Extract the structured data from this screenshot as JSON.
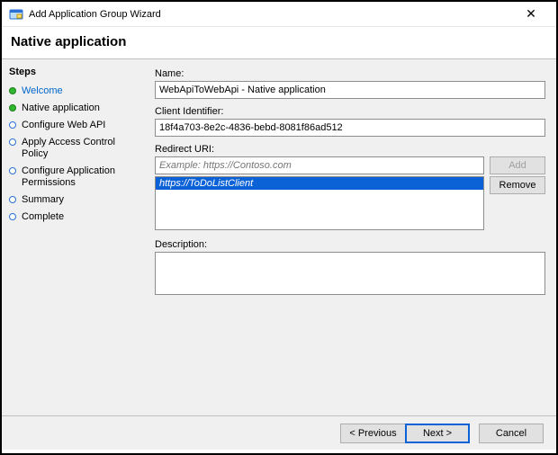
{
  "window": {
    "title": "Add Application Group Wizard",
    "close_symbol": "✕"
  },
  "header": {
    "page_title": "Native application"
  },
  "sidebar": {
    "steps_label": "Steps",
    "items": [
      {
        "label": "Welcome",
        "status": "done",
        "link": true
      },
      {
        "label": "Native application",
        "status": "done",
        "link": false
      },
      {
        "label": "Configure Web API",
        "status": "pending",
        "link": false
      },
      {
        "label": "Apply Access Control Policy",
        "status": "pending",
        "link": false
      },
      {
        "label": "Configure Application Permissions",
        "status": "pending",
        "link": false
      },
      {
        "label": "Summary",
        "status": "pending",
        "link": false
      },
      {
        "label": "Complete",
        "status": "pending",
        "link": false
      }
    ]
  },
  "form": {
    "name_label": "Name:",
    "name_value": "WebApiToWebApi - Native application",
    "client_id_label": "Client Identifier:",
    "client_id_value": "18f4a703-8e2c-4836-bebd-8081f86ad512",
    "redirect_uri_label": "Redirect URI:",
    "redirect_uri_placeholder": "Example: https://Contoso.com",
    "redirect_uri_value": "",
    "add_label": "Add",
    "remove_label": "Remove",
    "uri_list": [
      "https://ToDoListClient"
    ],
    "description_label": "Description:",
    "description_value": ""
  },
  "footer": {
    "previous_label": "< Previous",
    "next_label": "Next >",
    "cancel_label": "Cancel"
  }
}
